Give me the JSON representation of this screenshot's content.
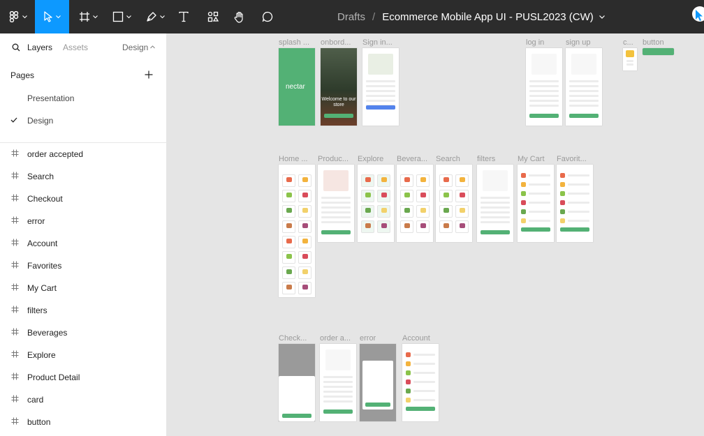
{
  "toolbar": {
    "tools": [
      {
        "name": "main-menu-icon",
        "has_caret": true
      },
      {
        "name": "move-tool-icon",
        "has_caret": true,
        "active": true
      },
      {
        "name": "frame-tool-icon",
        "has_caret": true
      },
      {
        "name": "shape-tool-icon",
        "has_caret": true
      },
      {
        "name": "pen-tool-icon",
        "has_caret": true
      },
      {
        "name": "text-tool-icon",
        "has_caret": false
      },
      {
        "name": "resources-icon",
        "has_caret": false
      },
      {
        "name": "hand-tool-icon",
        "has_caret": false
      },
      {
        "name": "comment-tool-icon",
        "has_caret": false
      }
    ],
    "breadcrumb_root": "Drafts",
    "breadcrumb_sep": "/",
    "file_name": "Ecommerce Mobile App UI - PUSL2023 (CW)",
    "accent": "#0d99ff"
  },
  "panel": {
    "tab_layers": "Layers",
    "tab_assets": "Assets",
    "tab_design": "Design",
    "pages_title": "Pages",
    "pages": [
      {
        "label": "Presentation",
        "selected": false
      },
      {
        "label": "Design",
        "selected": true
      }
    ],
    "layers": [
      "order accepted",
      "Search",
      "Checkout",
      "error",
      "Account",
      "Favorites",
      "My Cart",
      "filters",
      "Beverages",
      "Explore",
      "Product Detail",
      "card",
      "button"
    ]
  },
  "canvas": {
    "frames": [
      "splash ...",
      "onbord...",
      "Sign in...",
      "log in",
      "sign up",
      "c...",
      "button",
      "Home ...",
      "Produc...",
      "Explore",
      "Bevera...",
      "Search",
      "filters",
      "My Cart",
      "Favorit...",
      "Check...",
      "order a...",
      "error",
      "Account"
    ],
    "splash_logo": "nectar",
    "onboarding_text": "Welcome to our store",
    "brand_color": "#53b175"
  }
}
